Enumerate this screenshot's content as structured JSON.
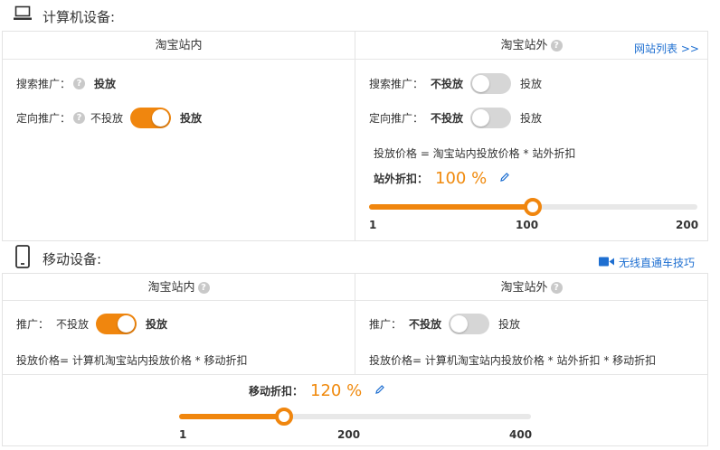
{
  "computer": {
    "title": "计算机设备:",
    "icon": "laptop-icon",
    "inside": {
      "header": "淘宝站内",
      "search_label": "搜索推广：",
      "search_value": "投放",
      "target_label": "定向推广：",
      "off_text": "不投放",
      "on_text": "投放",
      "target_toggle_on": true
    },
    "outside": {
      "header": "淘宝站外",
      "site_list_link": "网站列表 >>",
      "search_label": "搜索推广：",
      "target_label": "定向推广：",
      "off_text": "不投放",
      "on_text": "投放",
      "search_toggle_on": false,
      "target_toggle_on": false,
      "formula": "投放价格 = 淘宝站内投放价格 * 站外折扣",
      "discount_label": "站外折扣：",
      "discount_value": "100 %",
      "slider": {
        "min": 1,
        "max": 200,
        "value": 100,
        "ticks": [
          "1",
          "100",
          "200"
        ]
      }
    }
  },
  "mobile": {
    "title": "移动设备:",
    "icon": "mobile-phone-icon",
    "tips_link": "无线直通车技巧",
    "inside": {
      "header": "淘宝站内",
      "label": "推广：",
      "off_text": "不投放",
      "on_text": "投放",
      "toggle_on": true,
      "formula": "投放价格= 计算机淘宝站内投放价格 * 移动折扣"
    },
    "outside": {
      "header": "淘宝站外",
      "label": "推广：",
      "off_text": "不投放",
      "on_text": "投放",
      "toggle_on": false,
      "formula": "投放价格= 计算机淘宝站内投放价格 * 站外折扣 * 移动折扣"
    },
    "discount_label": "移动折扣：",
    "discount_value": "120 %",
    "slider": {
      "min": 1,
      "max": 400,
      "value": 120,
      "ticks": [
        "1",
        "200",
        "400"
      ]
    }
  },
  "colors": {
    "accent": "#f0860e",
    "link": "#1e6fd1",
    "toggle_off": "#d6d6d6"
  }
}
